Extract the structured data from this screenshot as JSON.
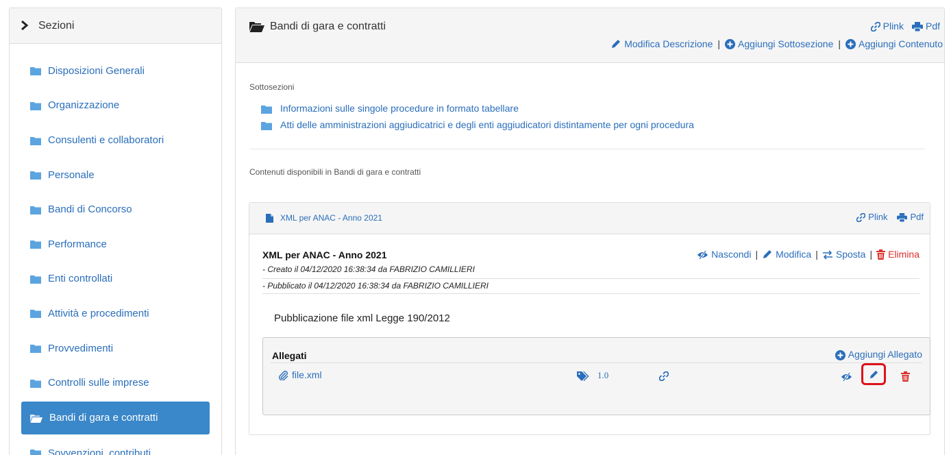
{
  "sidebar": {
    "title": "Sezioni",
    "items": [
      {
        "label": "Disposizioni Generali"
      },
      {
        "label": "Organizzazione"
      },
      {
        "label": "Consulenti e collaboratori"
      },
      {
        "label": "Personale"
      },
      {
        "label": "Bandi di Concorso"
      },
      {
        "label": "Performance"
      },
      {
        "label": "Enti controllati"
      },
      {
        "label": "Attività e procedimenti"
      },
      {
        "label": "Provvedimenti"
      },
      {
        "label": "Controlli sulle imprese"
      },
      {
        "label": "Bandi di gara e contratti",
        "active": true
      },
      {
        "label": "Sovvenzioni, contributi"
      }
    ]
  },
  "main": {
    "title": "Bandi di gara e contratti",
    "plink": "Plink",
    "pdf": "Pdf",
    "edit_description": "Modifica Descrizione",
    "add_subsection": "Aggiungi Sottosezione",
    "add_content": "Aggiungi Contenuto",
    "separator": "|",
    "subsections_label": "Sottosezioni",
    "subsections": [
      "Informazioni sulle singole procedure in formato tabellare",
      "Atti delle amministrazioni aggiudicatrici e degli enti aggiudicatori distintamente per ogni procedura"
    ],
    "contents_label": "Contenuti disponibili in Bandi di gara e contratti"
  },
  "card": {
    "header_title": "XML per ANAC - Anno 2021",
    "plink": "Plink",
    "pdf": "Pdf",
    "title": "XML per ANAC - Anno 2021",
    "actions": {
      "hide": "Nascondi",
      "edit": "Modifica",
      "move": "Sposta",
      "delete": "Elimina"
    },
    "created": "- Creato il 04/12/2020 16:38:34 da FABRIZIO CAMILLIERI",
    "published": "- Pubblicato il 04/12/2020 16:38:34 da FABRIZIO CAMILLIERI",
    "description": "Pubblicazione file xml Legge 190/2012",
    "attachments": {
      "title": "Allegati",
      "add": "Aggiungi Allegato",
      "files": [
        {
          "name": "file.xml",
          "version": "1.0"
        }
      ]
    }
  },
  "colors": {
    "link": "#2a6ebb",
    "active_bg": "#3a87c9",
    "danger": "#d9302c",
    "highlight": "#e0101a"
  }
}
